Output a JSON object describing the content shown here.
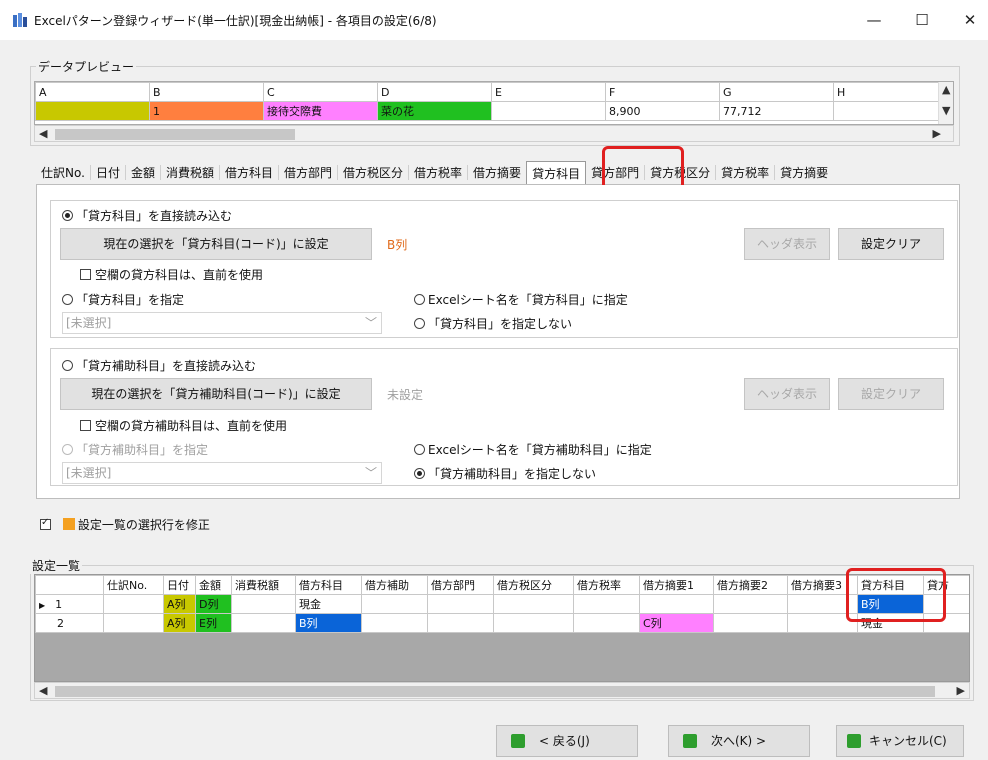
{
  "window": {
    "title": "Excelパターン登録ウィザード(単一仕訳)[現金出納帳] - 各項目の設定(6/8)",
    "minimize": "—",
    "maximize": "☐",
    "close": "✕"
  },
  "preview": {
    "label": "データプレビュー",
    "columns": [
      "A",
      "B",
      "C",
      "D",
      "E",
      "F",
      "G",
      "H"
    ],
    "row": [
      "",
      "1",
      "接待交際費",
      "菜の花",
      "",
      "8,900",
      "77,712",
      ""
    ],
    "cell_colors": [
      "#c8c800",
      "#ff7f3f",
      "#ff80ff",
      "#20c020",
      "#ffffff",
      "#ffffff",
      "#ffffff",
      "#ffffff"
    ]
  },
  "tabs": [
    "仕訳No.",
    "日付",
    "金額",
    "消費税額",
    "借方科目",
    "借方部門",
    "借方税区分",
    "借方税率",
    "借方摘要",
    "貸方科目",
    "貸方部門",
    "貸方税区分",
    "貸方税率",
    "貸方摘要"
  ],
  "active_tab_index": 9,
  "account_section": {
    "direct_read_label": "「貸方科目」を直接読み込む",
    "set_button": "現在の選択を「貸方科目(コード)」に設定",
    "selected_column": "B列",
    "header_button": "ヘッダ表示",
    "clear_button": "設定クリア",
    "blank_check_label": "空欄の貸方科目は、直前を使用",
    "specify_label": "「貸方科目」を指定",
    "combo_value": "[未選択]",
    "sheet_name_label": "Excelシート名を「貸方科目」に指定",
    "no_specify_label": "「貸方科目」を指定しない"
  },
  "subaccount_section": {
    "direct_read_label": "「貸方補助科目」を直接読み込む",
    "set_button": "現在の選択を「貸方補助科目(コード)」に設定",
    "status": "未設定",
    "header_button": "ヘッダ表示",
    "clear_button": "設定クリア",
    "blank_check_label": "空欄の貸方補助科目は、直前を使用",
    "specify_label": "「貸方補助科目」を指定",
    "combo_value": "[未選択]",
    "sheet_name_label": "Excelシート名を「貸方補助科目」に指定",
    "no_specify_label": "「貸方補助科目」を指定しない"
  },
  "modify_label": "設定一覧の選択行を修正",
  "settings_list": {
    "label": "設定一覧",
    "headers": [
      "",
      "仕訳No.",
      "日付",
      "金額",
      "消費税額",
      "借方科目",
      "借方補助",
      "借方部門",
      "借方税区分",
      "借方税率",
      "借方摘要1",
      "借方摘要2",
      "借方摘要3",
      "貸方科目",
      "貸方"
    ],
    "rows": [
      {
        "marker": "▶",
        "no": "1",
        "cells": [
          "",
          "A列",
          "D列",
          "",
          "現金",
          "",
          "",
          "",
          "",
          "",
          "",
          "",
          "B列",
          ""
        ]
      },
      {
        "marker": "",
        "no": "2",
        "cells": [
          "",
          "A列",
          "E列",
          "",
          "B列",
          "",
          "",
          "",
          "",
          "C列",
          "",
          "",
          "現金",
          ""
        ]
      }
    ]
  },
  "colors": {
    "yellow": "#c8c800",
    "green": "#20c020",
    "blue": "#0a64d8",
    "pink": "#ff80ff",
    "orange_text": "#e06a1a",
    "highlight_red": "#e02020"
  },
  "nav": {
    "back": "< 戻る(J)",
    "next": "次へ(K) >",
    "cancel": "キャンセル(C)"
  }
}
